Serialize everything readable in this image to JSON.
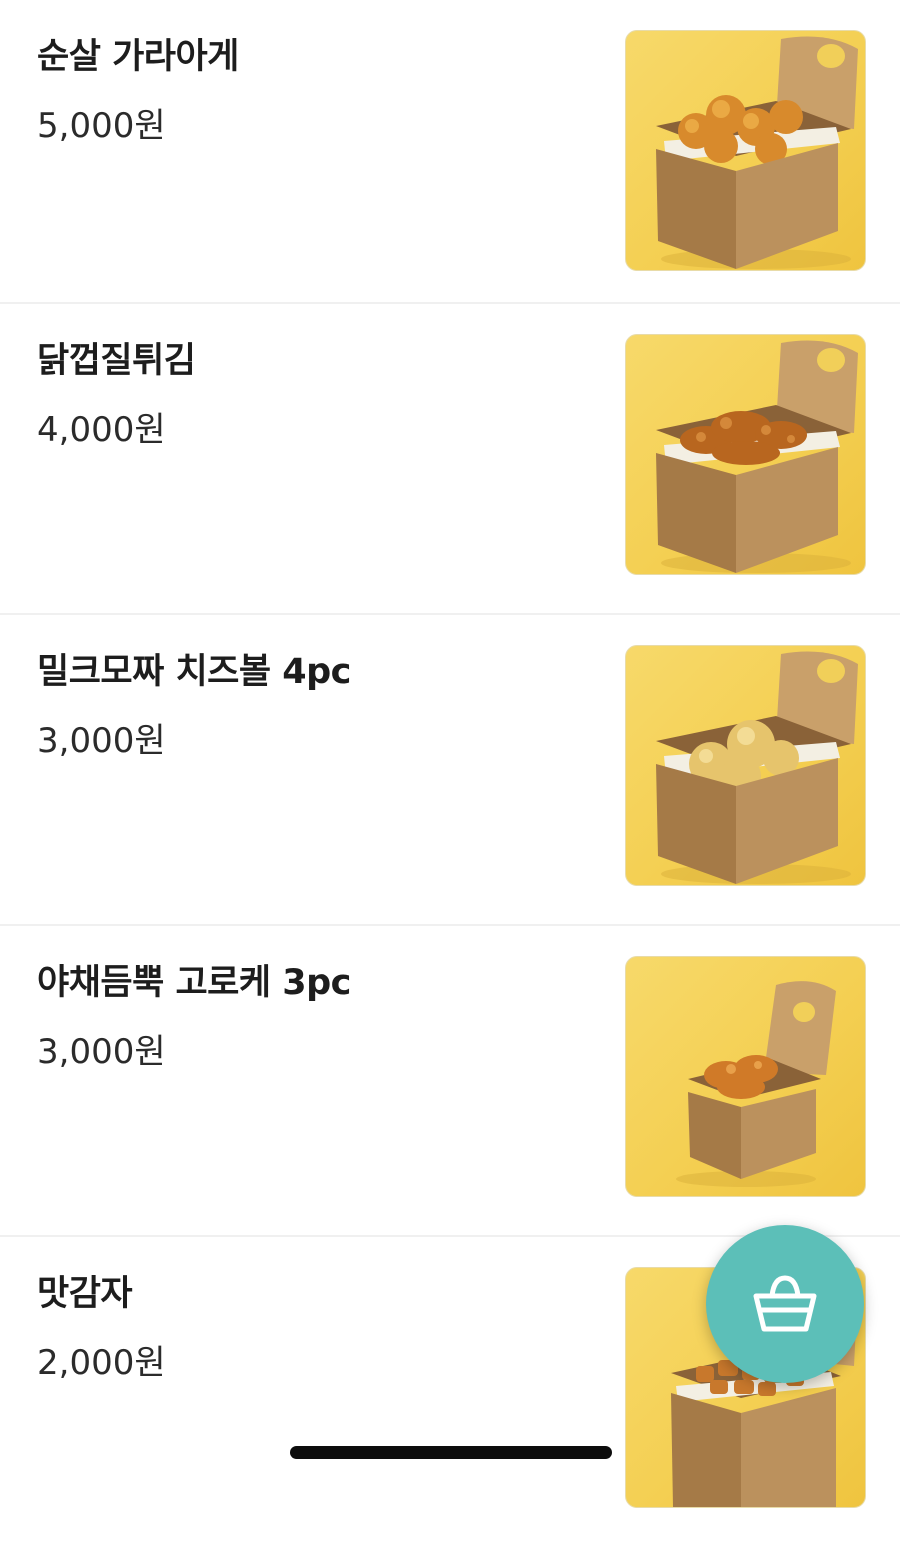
{
  "menu": {
    "items": [
      {
        "name": "순살 가라아게",
        "price": "5,000원",
        "thumbnail_icon": "boneless-karaage-box"
      },
      {
        "name": "닭껍질튀김",
        "price": "4,000원",
        "thumbnail_icon": "fried-chicken-skin-box"
      },
      {
        "name": "밀크모짜 치즈볼 4pc",
        "price": "3,000원",
        "thumbnail_icon": "cheese-ball-box"
      },
      {
        "name": "야채듬뿍 고로케 3pc",
        "price": "3,000원",
        "thumbnail_icon": "vegetable-croquette-box"
      },
      {
        "name": "맛감자",
        "price": "2,000원",
        "thumbnail_icon": "seasoned-potato-box"
      }
    ]
  },
  "cart_button": {
    "icon": "shopping-basket-icon",
    "color": "#5cbfb8"
  },
  "colors": {
    "thumbnail_background": "#f4cf52",
    "box_kraft": "#b98d5a",
    "divider": "#f0f0f0"
  }
}
